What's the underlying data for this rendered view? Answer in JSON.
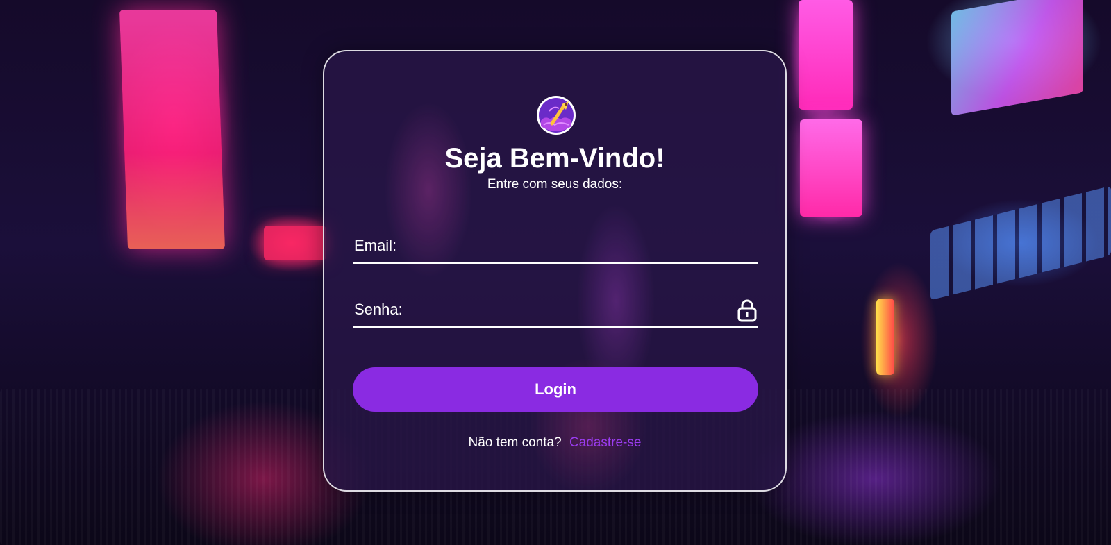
{
  "login": {
    "title": "Seja Bem-Vindo!",
    "subtitle": "Entre com seus dados:",
    "email": {
      "placeholder": "Email:",
      "value": ""
    },
    "password": {
      "placeholder": "Senha:",
      "value": "",
      "icon": "lock-icon"
    },
    "submit_label": "Login",
    "signup_prompt": "Não tem conta?",
    "signup_link": "Cadastre-se"
  },
  "logo": {
    "icon": "paintbrush-logo-icon"
  },
  "colors": {
    "accent": "#8a2be2",
    "link": "#9b3cf0",
    "text": "#ffffff",
    "card_border": "#ffffff"
  }
}
